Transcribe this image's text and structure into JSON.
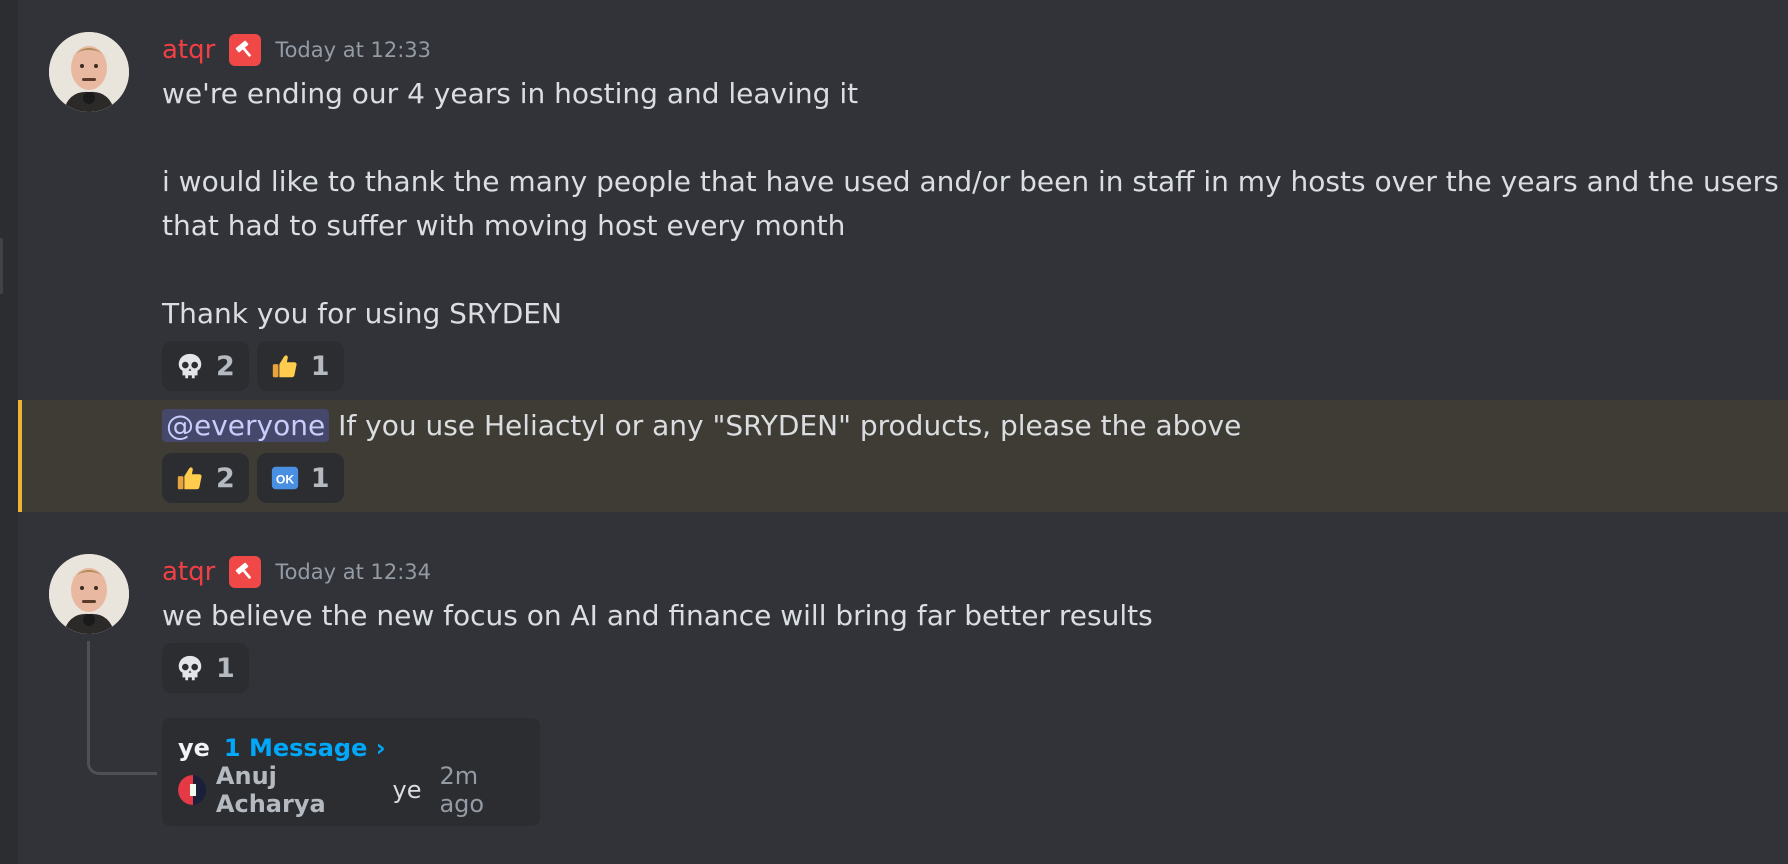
{
  "messages": [
    {
      "username": "atqr",
      "timestamp": "Today at 12:33",
      "lines": [
        "we're ending our 4 years in hosting and leaving it",
        "",
        "i would like to thank the many people that have used and/or been in staff in my hosts over the years and the users",
        "that had to suffer with moving host every month",
        "",
        "Thank you for using SRYDEN"
      ],
      "reactions": [
        {
          "emoji": "skull-emoji",
          "count": "2"
        },
        {
          "emoji": "thumbs-up-emoji",
          "count": "1"
        }
      ]
    },
    {
      "mention": "@everyone",
      "text": " If you use Heliactyl or any \"SRYDEN\" products, please the above",
      "reactions": [
        {
          "emoji": "thumbs-up-emoji",
          "count": "2"
        },
        {
          "emoji": "ok-button-emoji",
          "count": "1"
        }
      ]
    },
    {
      "username": "atqr",
      "timestamp": "Today at 12:34",
      "text": "we believe the new focus on AI and finance will bring far better results",
      "reactions": [
        {
          "emoji": "skull-emoji",
          "count": "1"
        }
      ],
      "thread": {
        "name": "ye",
        "count_label": "1 Message ›",
        "last_author": "Anuj Acharya",
        "last_message": "ye",
        "time": "2m ago"
      }
    }
  ],
  "colors": {
    "background": "#313338",
    "username": "#f23f43",
    "highlight": "#3f3c36",
    "highlight_border": "#f0b232",
    "link": "#00a8fc"
  }
}
